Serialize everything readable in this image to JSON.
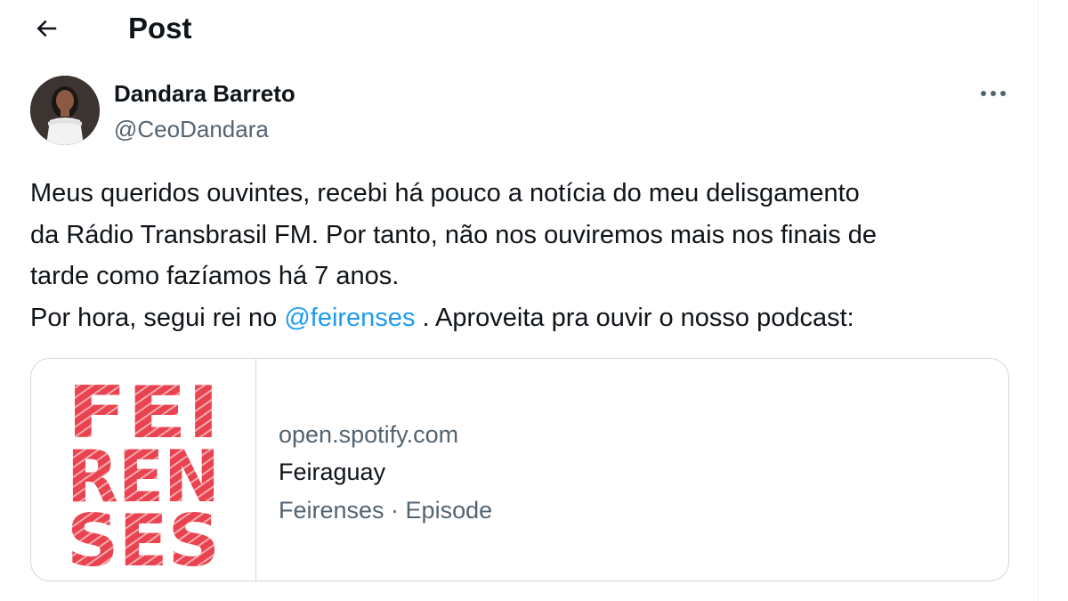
{
  "header": {
    "title": "Post",
    "back_icon": "arrow-left-icon"
  },
  "author": {
    "name": "Dandara Barreto",
    "handle": "@CeoDandara",
    "more_icon": "more-horizontal-icon"
  },
  "post": {
    "lines": [
      "Meus queridos ouvintes, recebi há pouco a notícia do meu delisgamento",
      "da Rádio Transbrasil FM. Por tanto, não nos ouviremos mais nos finais de",
      "tarde como fazíamos há 7 anos."
    ],
    "last_line_before": "Por hora, segui rei no ",
    "mention": "@feirenses",
    "last_line_after": " . Aproveita pra ouvir o nosso podcast:",
    "mention_color": "#1d9bf0"
  },
  "card": {
    "logo_lines": [
      "FEI",
      "REN",
      "SES"
    ],
    "logo_color": "#e8434f",
    "domain": "open.spotify.com",
    "title": "Feiraguay",
    "meta": "Feirenses · Episode"
  }
}
